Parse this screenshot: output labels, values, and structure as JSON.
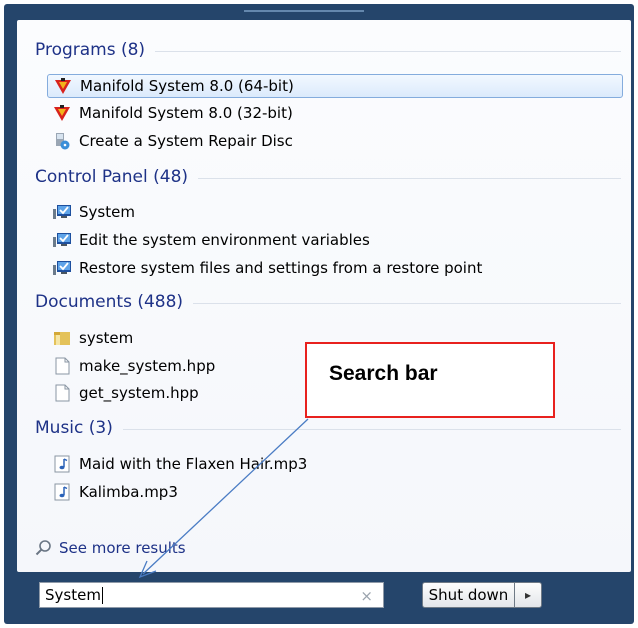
{
  "programs": {
    "heading": "Programs (8)",
    "items": [
      {
        "label": "Manifold System 8.0 (64-bit)",
        "icon": "manifold-icon",
        "selected": true
      },
      {
        "label": "Manifold System 8.0 (32-bit)",
        "icon": "manifold-icon"
      },
      {
        "label": "Create a System Repair Disc",
        "icon": "repair-disc-icon"
      }
    ]
  },
  "control_panel": {
    "heading": "Control Panel (48)",
    "items": [
      {
        "label": "System",
        "icon": "system-icon"
      },
      {
        "label": "Edit the system environment variables",
        "icon": "system-icon"
      },
      {
        "label": "Restore system files and settings from a restore point",
        "icon": "system-icon"
      }
    ]
  },
  "documents": {
    "heading": "Documents (488)",
    "items": [
      {
        "label": "system",
        "icon": "folder-icon"
      },
      {
        "label": "make_system.hpp",
        "icon": "file-icon"
      },
      {
        "label": "get_system.hpp",
        "icon": "file-icon"
      }
    ]
  },
  "music": {
    "heading": "Music (3)",
    "items": [
      {
        "label": "Maid with the Flaxen Hair.mp3",
        "icon": "audio-file-icon"
      },
      {
        "label": "Kalimba.mp3",
        "icon": "audio-file-icon"
      }
    ]
  },
  "see_more": "See more results",
  "search": {
    "value": "System",
    "clear_glyph": "×"
  },
  "shutdown": {
    "label": "Shut down",
    "arrow_glyph": "▸"
  },
  "callout": {
    "label": "Search bar",
    "border_color": "#e8211e"
  },
  "colors": {
    "heading": "#1e3287",
    "frame": "#25456b",
    "arrow": "#4a7cc4"
  }
}
